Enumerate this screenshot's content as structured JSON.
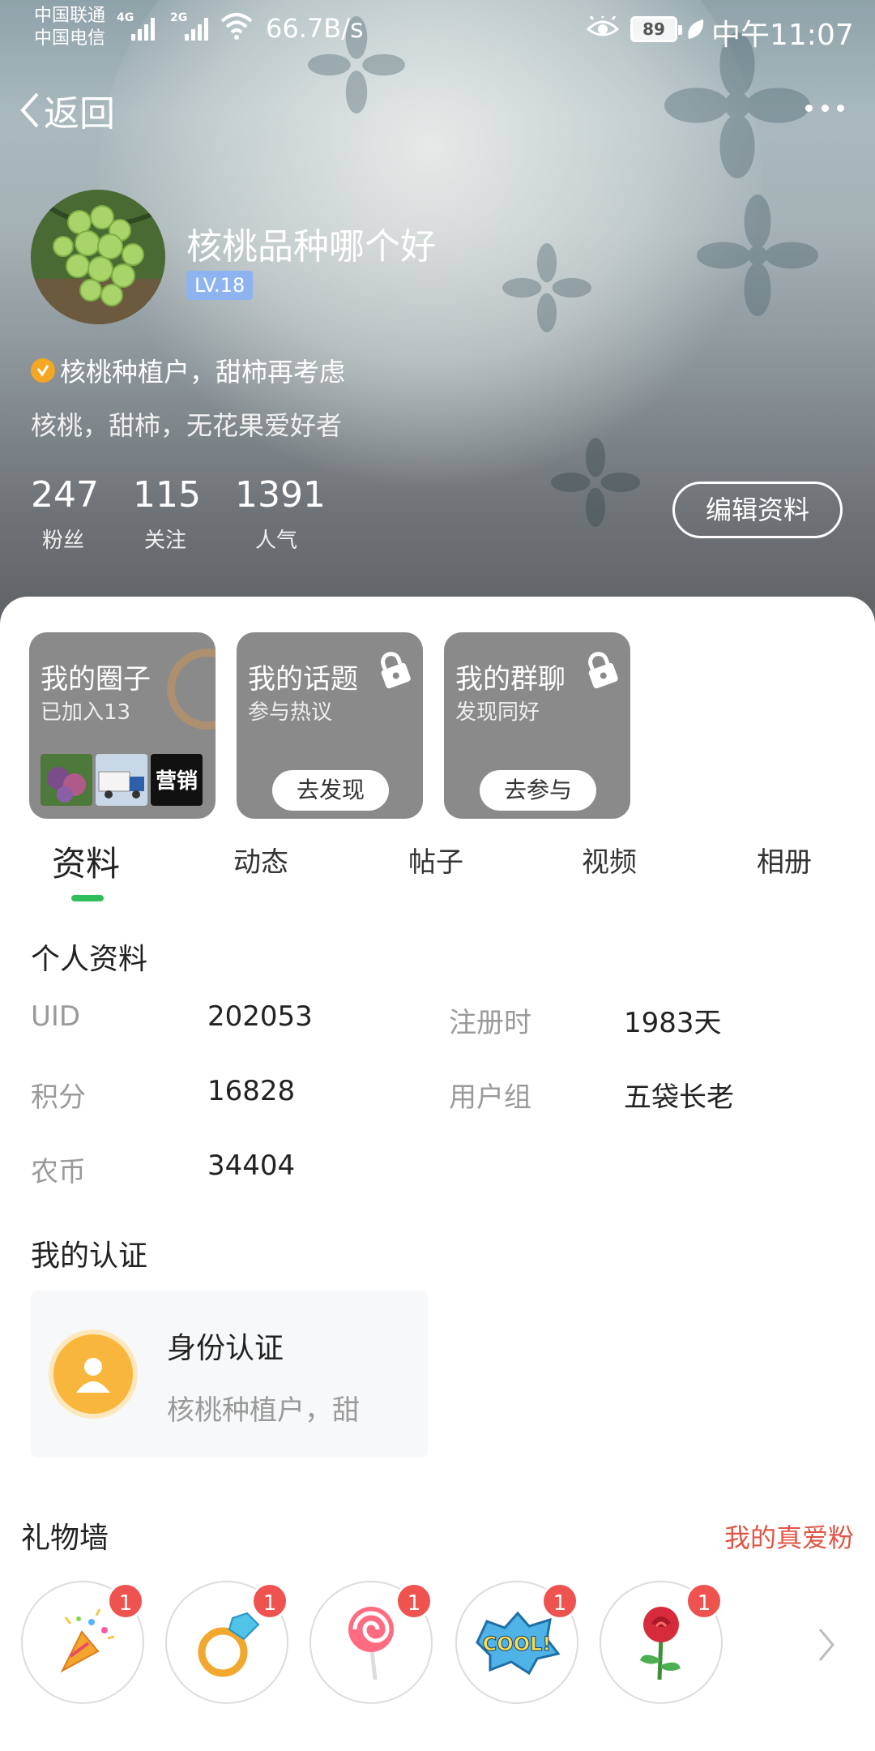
{
  "status_bar": {
    "carrier_1": "中国联通",
    "carrier_2": "中国电信",
    "net_1": "4G",
    "net_2": "2G",
    "speed": "66.7B/s",
    "battery": "89",
    "time": "中午11:07"
  },
  "nav": {
    "back_label": "返回"
  },
  "profile": {
    "username": "核桃品种哪个好",
    "level": "LV.18",
    "verified_text": "核桃种植户，甜柿再考虑",
    "bio": "核桃，甜柿，无花果爱好者",
    "stats": [
      {
        "value": "247",
        "label": "粉丝"
      },
      {
        "value": "115",
        "label": "关注"
      },
      {
        "value": "1391",
        "label": "人气"
      }
    ],
    "edit_label": "编辑资料"
  },
  "tiles": [
    {
      "title": "我的圈子",
      "subtitle": "已加入13",
      "thumb_text": "营销"
    },
    {
      "title": "我的话题",
      "subtitle": "参与热议",
      "cta": "去发现"
    },
    {
      "title": "我的群聊",
      "subtitle": "发现同好",
      "cta": "去参与"
    }
  ],
  "tabs": [
    "资料",
    "动态",
    "帖子",
    "视频",
    "相册"
  ],
  "active_tab": "资料",
  "info": {
    "title": "个人资料",
    "uid_label": "UID",
    "uid_value": "202053",
    "reg_label": "注册时",
    "reg_value": "1983天",
    "points_label": "积分",
    "points_value": "16828",
    "group_label": "用户组",
    "group_value": "五袋长老",
    "coin_label": "农币",
    "coin_value": "34404"
  },
  "certification": {
    "title": "我的认证",
    "card_title": "身份认证",
    "card_desc": "核桃种植户，甜"
  },
  "gift_wall": {
    "title": "礼物墙",
    "link": "我的真爱粉",
    "gifts": [
      {
        "icon": "party-popper-icon",
        "count": "1"
      },
      {
        "icon": "diamond-ring-icon",
        "count": "1"
      },
      {
        "icon": "lollipop-icon",
        "count": "1"
      },
      {
        "icon": "cool-sticker-icon",
        "count": "1",
        "text": "COOL!"
      },
      {
        "icon": "rose-icon",
        "count": "1"
      }
    ]
  },
  "colors": {
    "accent_green": "#2fbe5b",
    "level_blue": "#8db4f0",
    "link_red": "#e05545",
    "badge_red": "#ef5350",
    "cert_orange": "#f8b73c"
  }
}
